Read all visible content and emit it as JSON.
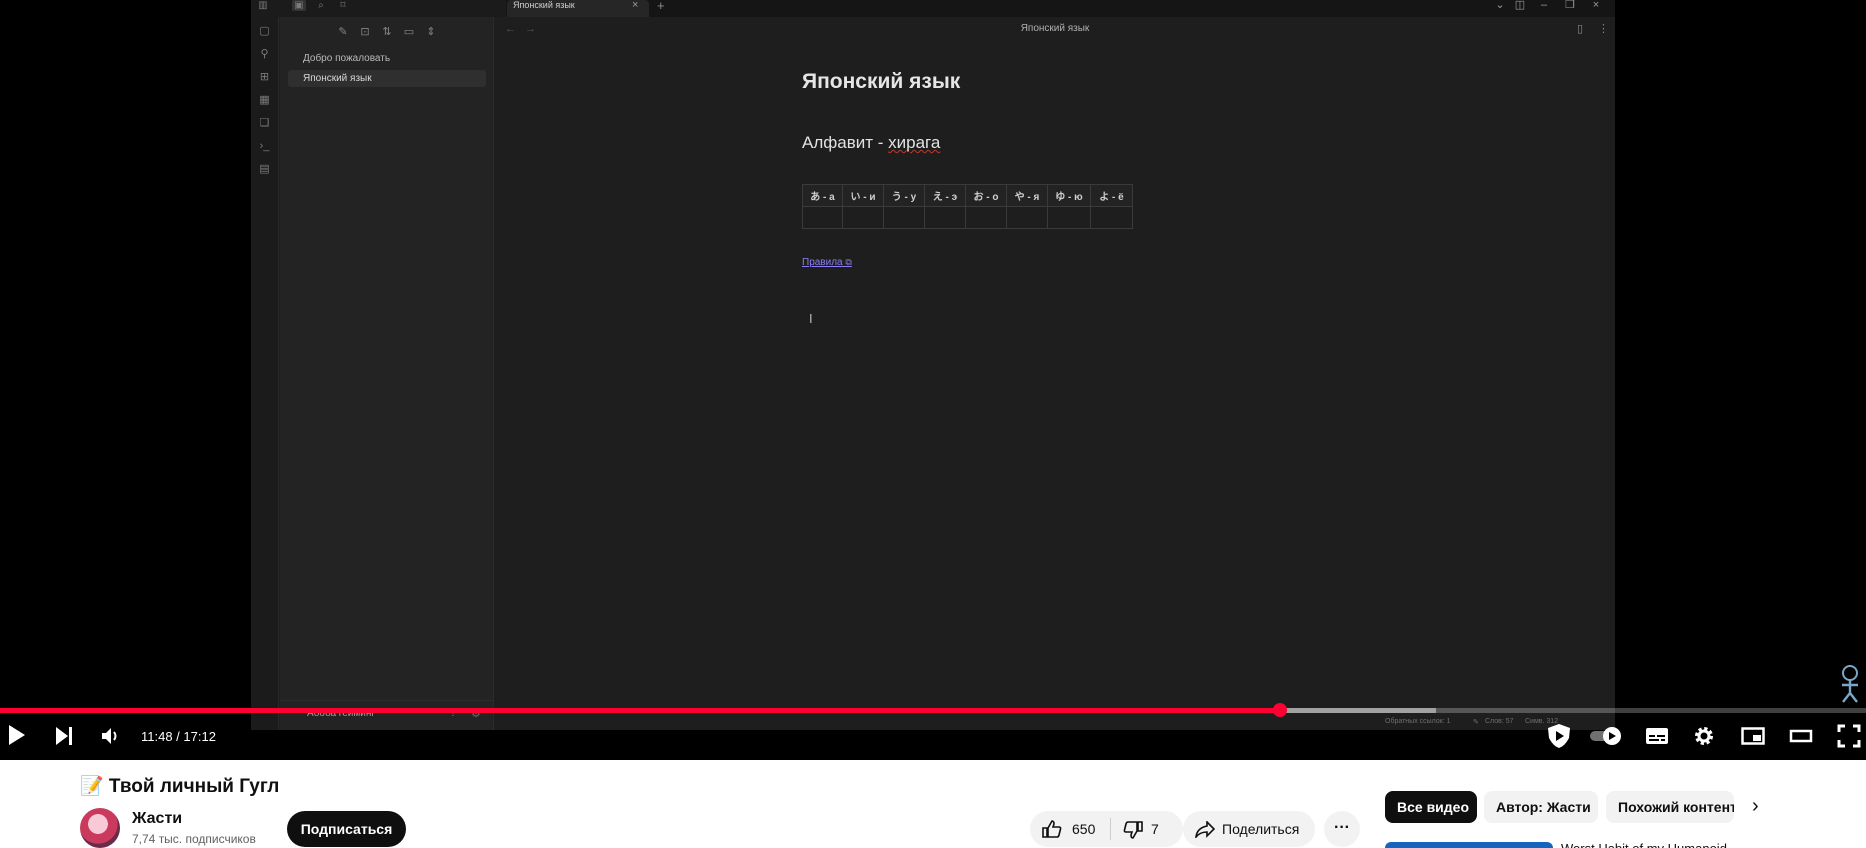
{
  "app": {
    "tab_title": "Японский язык",
    "window_title": "Японский язык",
    "sidebar_files": [
      "Добро пожаловать",
      "Японский язык"
    ],
    "active_file_index": 1,
    "vault_name": "Абоба гейминг"
  },
  "note": {
    "h1": "Японский язык",
    "h2_prefix": "Алфавит - ",
    "h2_misspelled": "хирага",
    "kana_headers": [
      "あ - а",
      "い - и",
      "う - у",
      "え - э",
      "お - о",
      "や - я",
      "ゆ - ю",
      "よ - ё"
    ],
    "link_text": "Правила"
  },
  "status": {
    "backlinks": "Обратных ссылок: 1",
    "words": "Слов: 57",
    "chars": "Симв. 312"
  },
  "player": {
    "time_current": "11:48",
    "time_total": "17:12",
    "time_display": "11:48 / 17:12",
    "progress_fraction": 0.6861,
    "buffer_fraction": 0.7694,
    "accent_color": "#ff0033"
  },
  "video": {
    "title": "📝 Твой личный Гугл",
    "channel": "Жасти",
    "subscribers": "7,74 тыс. подписчиков",
    "subscribe_label": "Подписаться",
    "likes": "650",
    "dislikes": "7",
    "share_label": "Поделиться"
  },
  "chips": [
    "Все видео",
    "Автор: Жасти",
    "Похожий контент"
  ],
  "recommendation": {
    "partial_title": "Worst Habit of my Humanoid"
  }
}
